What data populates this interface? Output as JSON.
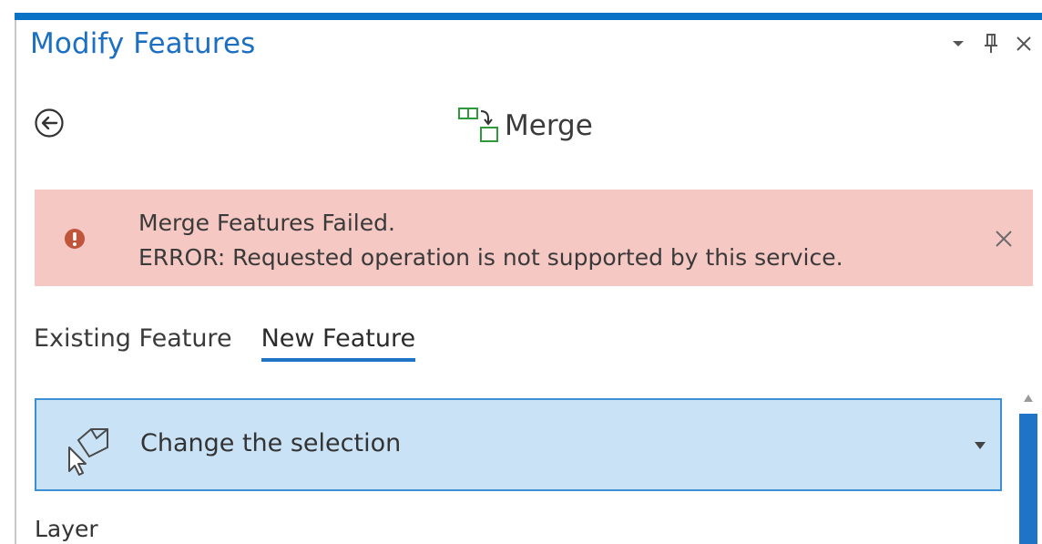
{
  "pane": {
    "title": "Modify Features",
    "controls": [
      {
        "name": "options-dropdown",
        "icon": "chevron-down-icon"
      },
      {
        "name": "pin",
        "icon": "pin-icon"
      },
      {
        "name": "close",
        "icon": "close-icon"
      }
    ]
  },
  "tool": {
    "back_icon": "back-arrow-icon",
    "icon": "merge-icon",
    "name": "Merge"
  },
  "error": {
    "icon": "error-icon",
    "title": "Merge Features Failed.",
    "message": "ERROR: Requested operation is not supported by this service.",
    "close_icon": "close-icon"
  },
  "tabs": [
    {
      "label": "Existing Feature",
      "active": false
    },
    {
      "label": "New Feature",
      "active": true
    }
  ],
  "selection": {
    "icon": "select-features-icon",
    "label": "Change the selection",
    "caret_icon": "caret-down-icon"
  },
  "fields": {
    "layer_label": "Layer"
  },
  "colors": {
    "accent": "#0b73c6",
    "title_blue": "#1c6fc2",
    "error_background": "#f6c8c3",
    "error_icon": "#c0553b",
    "selection_background": "#c9e2f5",
    "selection_border": "#3b8fd2",
    "merge_icon_green": "#2e9a3a"
  }
}
